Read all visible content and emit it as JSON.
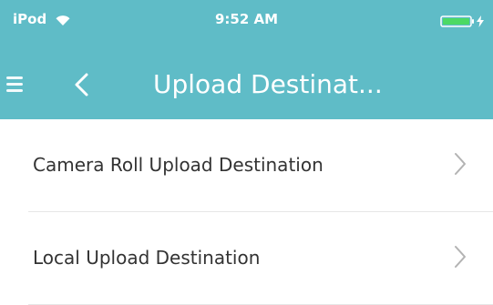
{
  "status_bar": {
    "carrier": "iPod",
    "time": "9:52 AM",
    "wifi_icon": "wifi-icon",
    "battery_icon": "battery-icon",
    "charge_icon": "charge-icon",
    "battery_color": "#4cd964"
  },
  "nav": {
    "menu_icon": "menu-icon",
    "back_icon": "chevron-left-icon",
    "title": "Upload Destinat..."
  },
  "list": {
    "items": [
      {
        "label": "Camera Roll Upload Destination",
        "icon": "chevron-right-icon"
      },
      {
        "label": "Local Upload Destination",
        "icon": "chevron-right-icon"
      }
    ]
  },
  "colors": {
    "header_bg": "#5fbcc7",
    "text": "#333333",
    "divider": "#e6e6e6",
    "chevron": "#b3b3b3"
  }
}
